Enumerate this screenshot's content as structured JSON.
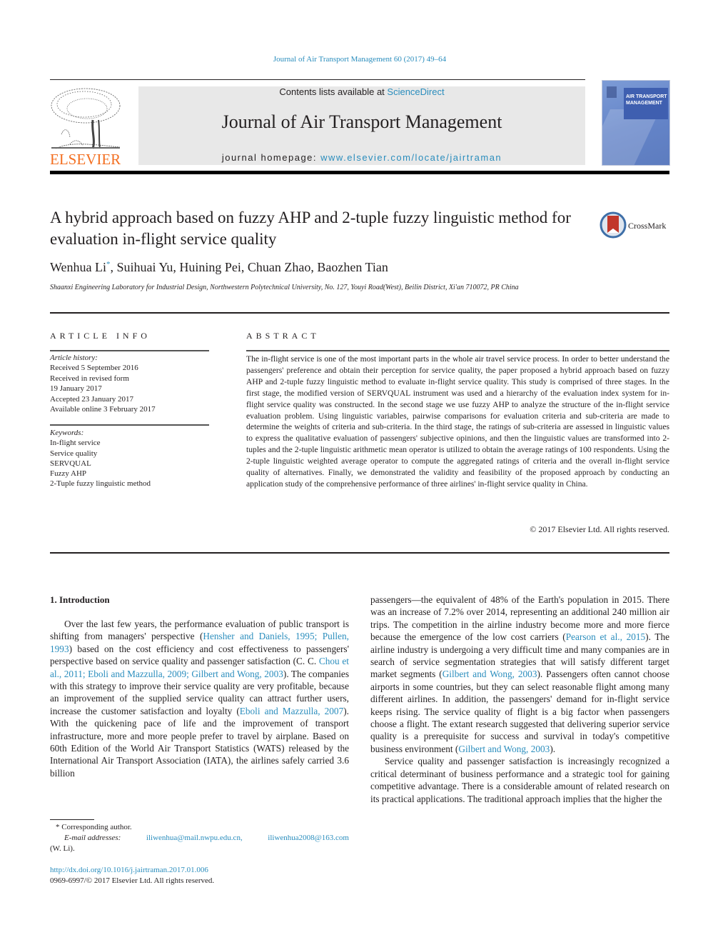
{
  "citation": "Journal of Air Transport Management 60 (2017) 49–64",
  "publisher": {
    "wordmark": "ELSEVIER",
    "brand_color": "#f36f21"
  },
  "masthead": {
    "contents_prefix": "Contents lists available at ",
    "contents_link": "ScienceDirect",
    "journal_title": "Journal of Air Transport Management",
    "homepage_prefix": "journal homepage: ",
    "homepage_link": "www.elsevier.com/locate/jairtraman",
    "cover_title_line1": "AIR TRANSPORT",
    "cover_title_line2": "MANAGEMENT"
  },
  "crossmark": {
    "label": "CrossMark"
  },
  "article": {
    "title": "A hybrid approach based on fuzzy AHP and 2-tuple fuzzy linguistic method for evaluation in-flight service quality",
    "authors": [
      {
        "name": "Wenhua Li",
        "mark": "*"
      },
      {
        "name": "Suihuai Yu"
      },
      {
        "name": "Huining Pei"
      },
      {
        "name": "Chuan Zhao"
      },
      {
        "name": "Baozhen Tian"
      }
    ],
    "authors_rest": ", Suihuai Yu, Huining Pei, Chuan Zhao, Baozhen Tian",
    "affiliation": "Shaanxi Engineering Laboratory for Industrial Design, Northwestern Polytechnical University, No. 127, Youyi Road(West), Beilin District, Xi'an 710072, PR China"
  },
  "article_info": {
    "label": "ARTICLE INFO",
    "history_label": "Article history:",
    "history": [
      "Received 5 September 2016",
      "Received in revised form",
      "19 January 2017",
      "Accepted 23 January 2017",
      "Available online 3 February 2017"
    ],
    "keywords_label": "Keywords:",
    "keywords": [
      "In-flight service",
      "Service quality",
      "SERVQUAL",
      "Fuzzy AHP",
      "2-Tuple fuzzy linguistic method"
    ]
  },
  "abstract": {
    "label": "ABSTRACT",
    "text": "The in-flight service is one of the most important parts in the whole air travel service process. In order to better understand the passengers' preference and obtain their perception for service quality, the paper proposed a hybrid approach based on fuzzy AHP and 2-tuple fuzzy linguistic method to evaluate in-flight service quality. This study is comprised of three stages. In the first stage, the modified version of SERVQUAL instrument was used and a hierarchy of the evaluation index system for in-flight service quality was constructed. In the second stage we use fuzzy AHP to analyze the structure of the in-flight service evaluation problem. Using linguistic variables, pairwise comparisons for evaluation criteria and sub-criteria are made to determine the weights of criteria and sub-criteria. In the third stage, the ratings of sub-criteria are assessed in linguistic values to express the qualitative evaluation of passengers' subjective opinions, and then the linguistic values are transformed into 2-tuples and the 2-tuple lin­guistic arithmetic mean operator is utilized to obtain the average ratings of 100 respondents. Using the 2-­tuple linguistic weighted average operator to compute the aggregated ratings of criteria and the overall in-flight service quality of alternatives. Finally, we demonstrated the validity and feasibility of the pro­posed approach by conducting an application study of the comprehensive performance of three airlines' in-flight service quality in China.",
    "copyright": "© 2017 Elsevier Ltd. All rights reserved."
  },
  "body": {
    "section_heading": "1.  Introduction",
    "left_col": [
      {
        "t": "Over the last few years, the performance evaluation of public transport is shifting from managers' perspective ("
      },
      {
        "link": "Hensher and Daniels, 1995; Pullen, 1993"
      },
      {
        "t": ") based on the cost efficiency and cost effectiveness to passengers' perspective based on service quality and passenger satisfaction (C. C. "
      },
      {
        "link": "Chou et al., 2011; Eboli and Mazzulla, 2009; Gilbert and Wong, 2003"
      },
      {
        "t": "). The companies with this strategy to improve their service quality are very profitable, because an improvement of the supplied service quality can attract further users, increase the customer satisfaction and loyalty ("
      },
      {
        "link": "Eboli and Mazzulla, 2007"
      },
      {
        "t": "). With the quickening pace of life and the improvement of transport infrastructure, more and more people prefer to travel by airplane. Based on 60th Edition of the World Air Transport Statistics (WATS) released by the International Air Transport Association (IATA), the airlines safely carried 3.6 billion"
      }
    ],
    "right_col_p1": [
      {
        "t": "passengers—the equivalent of 48% of the Earth's population in 2015. There was an increase of 7.2% over 2014, representing an additional 240 million air trips. The competition in the airline in­dustry become more and more fierce because the emergence of the low cost carriers ("
      },
      {
        "link": "Pearson et al., 2015"
      },
      {
        "t": "). The airline industry is un­dergoing a very difficult time and many companies are in search of service segmentation strategies that will satisfy different target market segments ("
      },
      {
        "link": "Gilbert and Wong, 2003"
      },
      {
        "t": "). Passengers often cannot choose airports in some countries, but they can select reasonable flight among many different airlines. In addition, the passengers' demand for in-flight service keeps rising. The service quality of flight is a big factor when passengers choose a flight. The extant research suggested that delivering superior service quality is a prerequisite for success and survival in today's competitive business environment ("
      },
      {
        "link": "Gilbert and Wong, 2003"
      },
      {
        "t": ")."
      }
    ],
    "right_col_p2": "Service quality and passenger satisfaction is increasingly recognized a critical determinant of business performance and a strategic tool for gaining competitive advantage. There is a considerable amount of related research on its practical applica­tions. The traditional approach implies that the higher the"
  },
  "footnote": {
    "corresponding": "* Corresponding author.",
    "email_label": "E-mail addresses:",
    "email_1": "iliwenhua@mail.nwpu.edu.cn,",
    "email_2": "iliwenhua2008@163.com",
    "email_owner": "(W. Li)."
  },
  "doi": {
    "link": "http://dx.doi.org/10.1016/j.jairtraman.2017.01.006",
    "issn_line": "0969-6997/© 2017 Elsevier Ltd. All rights reserved."
  }
}
